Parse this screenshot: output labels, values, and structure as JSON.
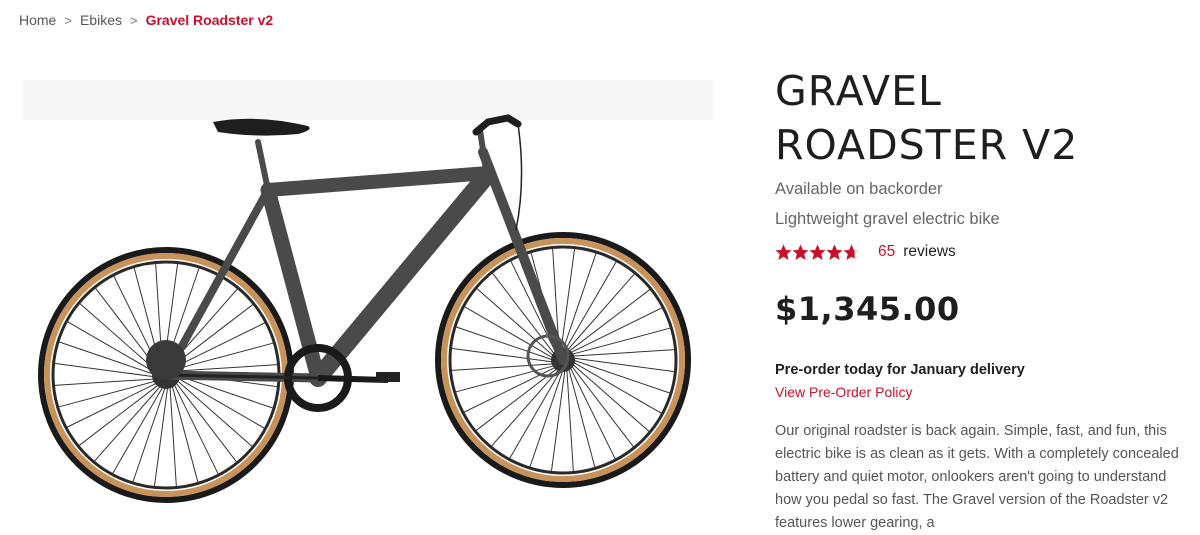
{
  "breadcrumb": {
    "items": [
      "Home",
      "Ebikes"
    ],
    "separator": ">",
    "current": "Gravel Roadster v2"
  },
  "product": {
    "title": "GRAVEL ROADSTER V2",
    "stock_status": "Available on backorder",
    "subtitle": "Lightweight gravel electric bike",
    "rating": {
      "value": 4.7,
      "max": 5,
      "count": "65",
      "count_label": "reviews"
    },
    "price": "$1,345.00",
    "preorder_note": "Pre-order today for January delivery",
    "policy_link": "View Pre-Order Policy",
    "description": "Our original roadster is back again. Simple, fast, and fun, this electric bike is as clean as it gets. With a completely concealed battery and quiet motor, onlookers aren't going to understand how you pedal so fast. The Gravel version of the Roadster v2 features lower gearing, a",
    "image": "bike-photo"
  },
  "colors": {
    "accent": "#c8102e",
    "frame": "#4a4a4a",
    "tire": "#c8935a"
  }
}
